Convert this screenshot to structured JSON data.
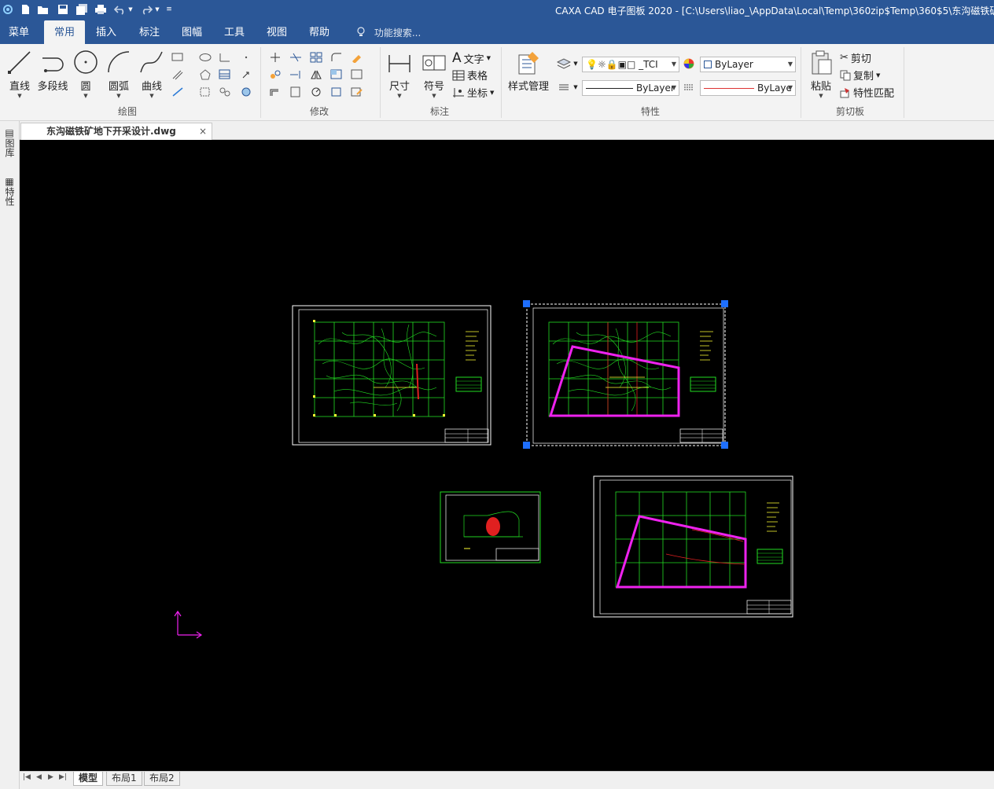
{
  "titlebar": {
    "title": "CAXA CAD 电子图板 2020 - [C:\\Users\\liao_\\AppData\\Local\\Temp\\360zip$Temp\\360$5\\东沟磁铁矿地下开"
  },
  "menubar": {
    "tabs": [
      "菜单",
      "常用",
      "插入",
      "标注",
      "图幅",
      "工具",
      "视图",
      "帮助"
    ],
    "active_tab": "常用",
    "search_placeholder": "功能搜索..."
  },
  "ribbon": {
    "draw": {
      "label": "绘图",
      "line": "直线",
      "polyline": "多段线",
      "circle": "圆",
      "arc": "圆弧",
      "curve": "曲线"
    },
    "modify": {
      "label": "修改"
    },
    "annotate": {
      "label": "标注",
      "dimension": "尺寸",
      "symbol": "符号",
      "text": "文字",
      "table": "表格",
      "coordinate": "坐标"
    },
    "properties": {
      "label": "特性",
      "style_manager": "样式管理",
      "layer_name": "_TCI",
      "color_value": "ByLayer",
      "linetype_value": "ByLayer",
      "lineweight_value": "ByLaye"
    },
    "clipboard": {
      "label": "剪切板",
      "paste": "粘贴",
      "cut": "剪切",
      "copy": "复制",
      "match": "特性匹配"
    }
  },
  "document": {
    "tab_label": "东沟磁铁矿地下开采设计.dwg",
    "close_glyph": "×"
  },
  "left_panel": {
    "items": [
      "图库",
      "特性"
    ]
  },
  "layout_tabs": {
    "tabs": [
      "模型",
      "布局1",
      "布局2"
    ],
    "active": "模型"
  },
  "colors": {
    "title_blue": "#2b5797",
    "canvas": "#000000",
    "grid_green": "#22dd22",
    "boundary_magenta": "#ee22ee",
    "grip_blue": "#1e6fff"
  }
}
